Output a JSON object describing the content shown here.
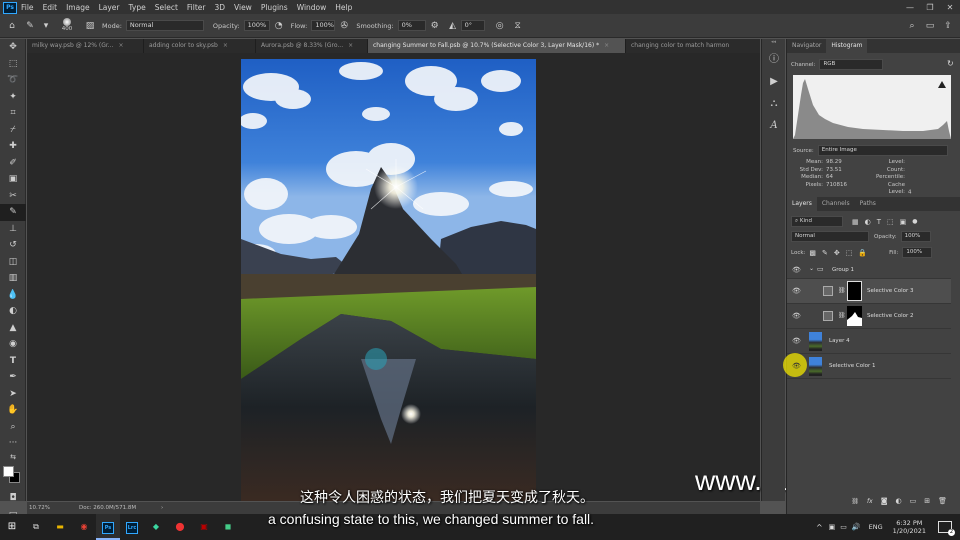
{
  "menubar": {
    "app_logo": "Ps",
    "items": [
      "File",
      "Edit",
      "Image",
      "Layer",
      "Type",
      "Select",
      "Filter",
      "3D",
      "View",
      "Plugins",
      "Window",
      "Help"
    ],
    "window_controls": [
      "—",
      "❐",
      "✕"
    ]
  },
  "options": {
    "brush_size": "400",
    "mode_label": "Mode:",
    "mode_value": "Normal",
    "opacity_label": "Opacity:",
    "opacity_value": "100%",
    "flow_label": "Flow:",
    "flow_value": "100%",
    "smoothing_label": "Smoothing:",
    "smoothing_value": "0%",
    "angle_value": "0°"
  },
  "tabs": [
    {
      "label": "milky way.psb @ 12% (Gr...",
      "active": false
    },
    {
      "label": "adding color to sky.psb",
      "active": false
    },
    {
      "label": "Aurora.psb @ 8.33% (Gro...",
      "active": false
    },
    {
      "label": "changing Summer to Fall.psb @ 10.7% (Selective Color 3, Layer Mask/16) *",
      "active": true
    },
    {
      "label": "changing color to match harmon",
      "active": false
    }
  ],
  "status": {
    "zoom": "10.72%",
    "doc": "Doc: 260.0M/571.8M",
    "arrow": "›"
  },
  "histogram": {
    "tabs": [
      "Navigator",
      "Histogram"
    ],
    "channel_label": "Channel:",
    "channel_value": "RGB",
    "source_label": "Source:",
    "source_value": "Entire Image",
    "stats_left_labels": [
      "Mean:",
      "Std Dev:",
      "Median:",
      "Pixels:"
    ],
    "stats_left_values": [
      "98.29",
      "73.51",
      "64",
      "710816"
    ],
    "stats_right_labels": [
      "Level:",
      "Count:",
      "Percentile:",
      "Cache Level:"
    ],
    "stats_right_values": [
      "",
      "",
      "",
      "4"
    ]
  },
  "layers": {
    "tabs": [
      "Layers",
      "Channels",
      "Paths"
    ],
    "kind_label": "Kind",
    "blend_mode": "Normal",
    "opacity_label": "Opacity:",
    "opacity_value": "100%",
    "lock_label": "Lock:",
    "fill_label": "Fill:",
    "fill_value": "100%",
    "items": [
      {
        "name": "Group 1"
      },
      {
        "name": "Selective Color 3"
      },
      {
        "name": "Selective Color 2"
      },
      {
        "name": "Layer 4"
      },
      {
        "name": "Selective Color 1"
      }
    ]
  },
  "taskbar": {
    "lang": "ENG",
    "time": "6:32 PM",
    "date": "1/20/2021",
    "notif_count": "2"
  },
  "overlay": {
    "watermark": "www.hunls.com",
    "subtitle_cn": "这种令人困惑的状态，我们把夏天变成了秋天。",
    "subtitle_en": "a confusing state to this, we changed summer to fall."
  },
  "colors": {
    "accent_blue": "#31a8ff",
    "cursor_highlight": "#f2e600"
  }
}
